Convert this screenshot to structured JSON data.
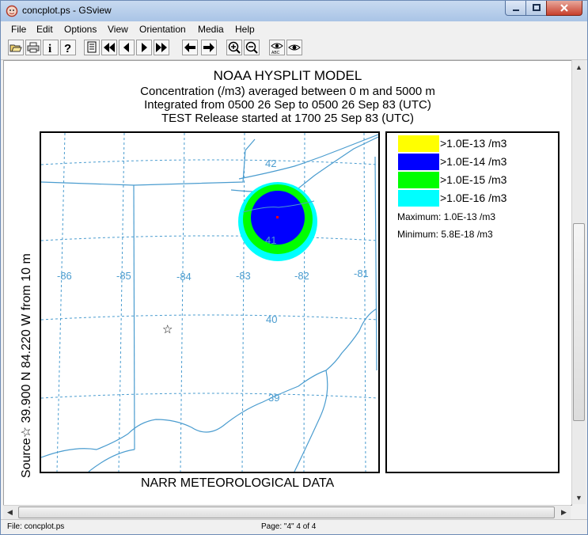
{
  "window": {
    "title": "concplot.ps - GSview"
  },
  "menu": [
    "File",
    "Edit",
    "Options",
    "View",
    "Orientation",
    "Media",
    "Help"
  ],
  "toolbar_icons": [
    "open-icon",
    "print-icon",
    "info-icon",
    "help-icon",
    "goto-page-icon",
    "first-page-icon",
    "prev-page-icon",
    "next-page-icon",
    "last-page-icon",
    "back-icon",
    "forward-icon",
    "zoom-in-icon",
    "zoom-out-icon",
    "eye-text-icon",
    "eye-icon"
  ],
  "plot": {
    "title": "NOAA HYSPLIT MODEL",
    "line2": "Concentration  (/m3) averaged between      0 m and  5000 m",
    "line3": "Integrated from 0500 26 Sep to 0500 26 Sep 83 (UTC)",
    "line4": "TEST Release started at 1700 25 Sep 83 (UTC)",
    "left_label": "Source☆ 39.900  N  84.220  W     from     10 m",
    "bottom_label": "NARR METEOROLOGICAL DATA",
    "longitudes": [
      "-86",
      "-85",
      "-84",
      "-83",
      "-82",
      "-81"
    ],
    "latitudes": [
      "42",
      "41",
      "40",
      "39"
    ],
    "source_marker": "☆"
  },
  "legend": {
    "items": [
      {
        "label": ">1.0E-13 /m3",
        "color": "#ffff00"
      },
      {
        "label": ">1.0E-14 /m3",
        "color": "#0000ff"
      },
      {
        "label": ">1.0E-15 /m3",
        "color": "#00ff00"
      },
      {
        "label": ">1.0E-16 /m3",
        "color": "#00ffff"
      }
    ],
    "maximum": "Maximum: 1.0E-13 /m3",
    "minimum": "Minimum: 5.8E-18 /m3"
  },
  "status": {
    "file": "File: concplot.ps",
    "page": "Page: \"4\"  4 of 4"
  },
  "colors": {
    "map_lines": "#4a9ccf",
    "accent": "#ff0000"
  }
}
